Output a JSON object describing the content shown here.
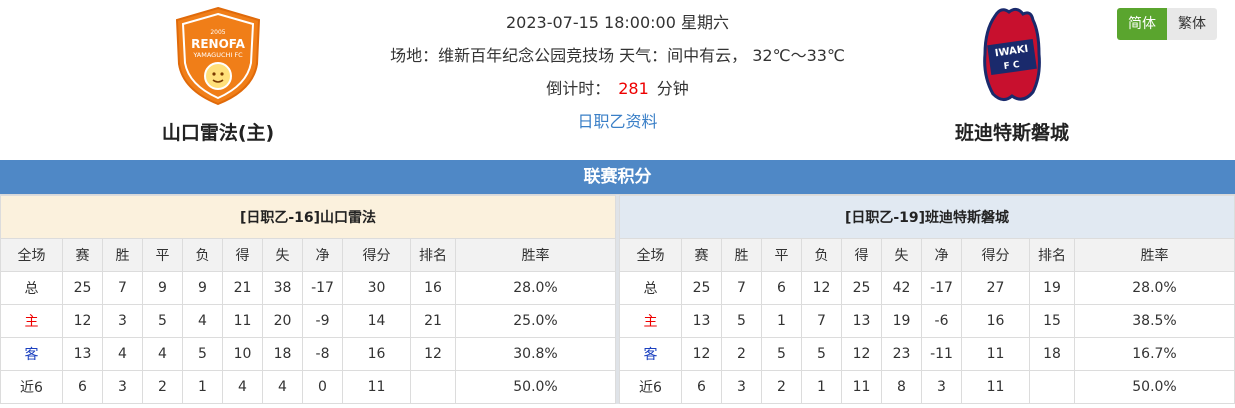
{
  "match": {
    "datetime": "2023-07-15 18:00:00 星期六",
    "venue_weather": "场地：维新百年纪念公园竞技场 天气：间中有云， 32℃～33℃",
    "countdown_label": "倒计时：",
    "countdown_value": "281",
    "countdown_unit": "分钟",
    "league_link": "日职乙资料"
  },
  "home_team": {
    "name": "山口雷法(主)",
    "logo_text": "RENOFA",
    "logo_sub": "YAMAGUCHI FC",
    "logo_year": "2005"
  },
  "away_team": {
    "name": "班迪特斯磐城",
    "logo_text": "IWAKI",
    "logo_sub": "F C"
  },
  "lang": {
    "simplified": "简体",
    "traditional": "繁体"
  },
  "section_title": "联赛积分",
  "columns": [
    "全场",
    "赛",
    "胜",
    "平",
    "负",
    "得",
    "失",
    "净",
    "得分",
    "排名",
    "胜率"
  ],
  "home_table": {
    "caption": "[日职乙-16]山口雷法",
    "rows": [
      [
        "总",
        "25",
        "7",
        "9",
        "9",
        "21",
        "38",
        "-17",
        "30",
        "16",
        "28.0%"
      ],
      [
        "主",
        "12",
        "3",
        "5",
        "4",
        "11",
        "20",
        "-9",
        "14",
        "21",
        "25.0%"
      ],
      [
        "客",
        "13",
        "4",
        "4",
        "5",
        "10",
        "18",
        "-8",
        "16",
        "12",
        "30.8%"
      ],
      [
        "近6",
        "6",
        "3",
        "2",
        "1",
        "4",
        "4",
        "0",
        "11",
        "",
        "50.0%"
      ]
    ]
  },
  "away_table": {
    "caption": "[日职乙-19]班迪特斯磐城",
    "rows": [
      [
        "总",
        "25",
        "7",
        "6",
        "12",
        "25",
        "42",
        "-17",
        "27",
        "19",
        "28.0%"
      ],
      [
        "主",
        "13",
        "5",
        "1",
        "7",
        "13",
        "19",
        "-6",
        "16",
        "15",
        "38.5%"
      ],
      [
        "客",
        "12",
        "2",
        "5",
        "5",
        "12",
        "23",
        "-11",
        "11",
        "18",
        "16.7%"
      ],
      [
        "近6",
        "6",
        "3",
        "2",
        "1",
        "11",
        "8",
        "3",
        "11",
        "",
        "50.0%"
      ]
    ]
  },
  "colors": {
    "header_bar": "#4f88c6",
    "home_caption_bg": "#fbf1dd",
    "away_caption_bg": "#e1e9f2",
    "lang_active": "#5aa52e",
    "countdown": "#e00000"
  }
}
